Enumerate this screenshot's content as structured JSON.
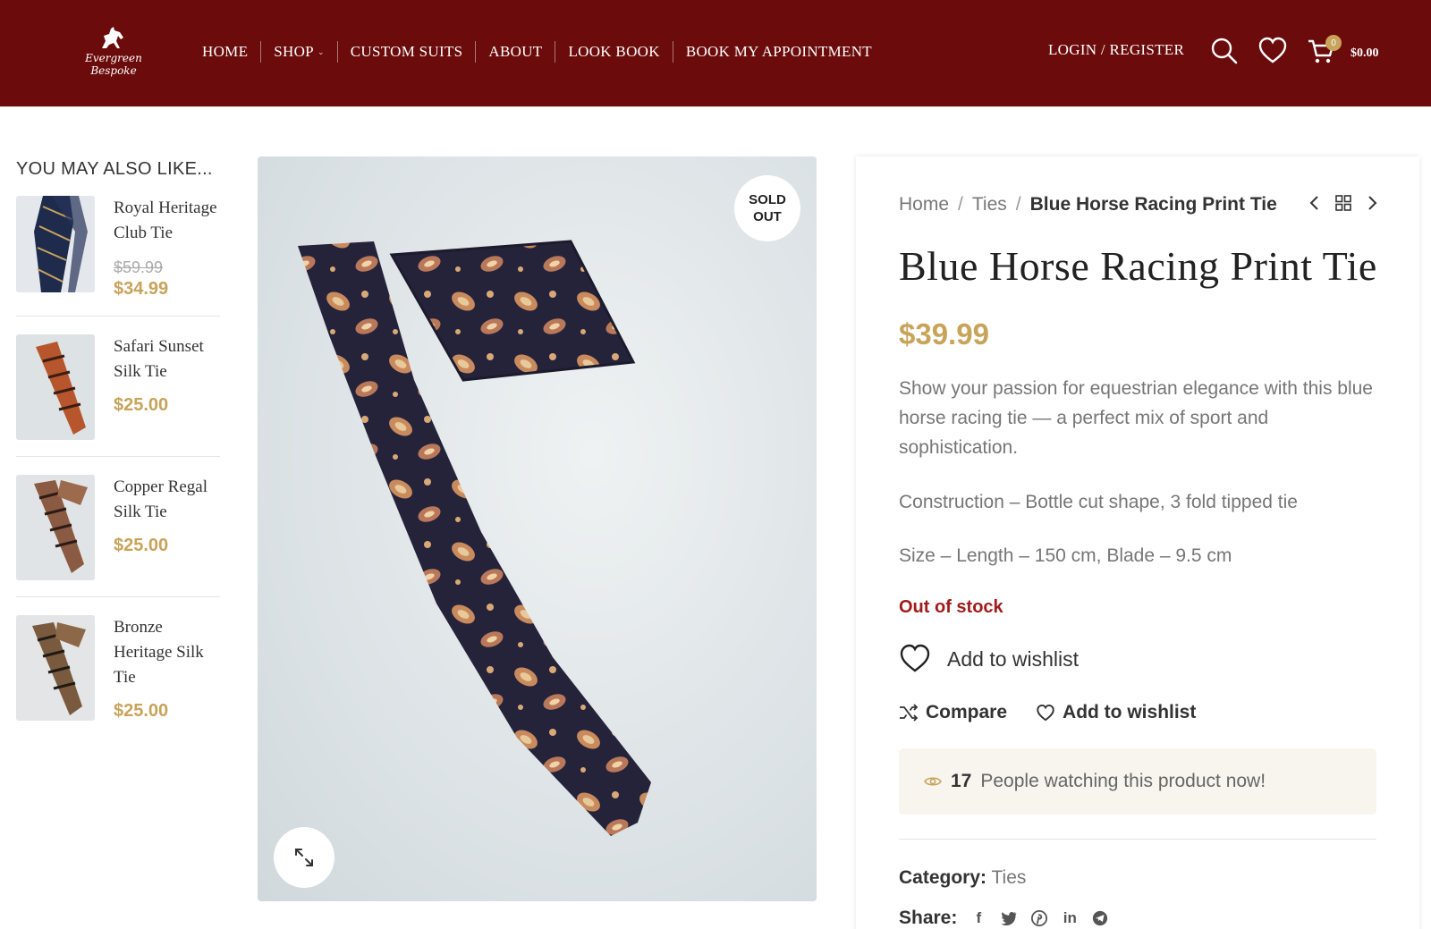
{
  "header": {
    "logo_text": "Evergreen Bespoke",
    "nav": [
      {
        "label": "HOME"
      },
      {
        "label": "SHOP"
      },
      {
        "label": "CUSTOM SUITS"
      },
      {
        "label": "ABOUT"
      },
      {
        "label": "LOOK BOOK"
      },
      {
        "label": "BOOK MY APPOINTMENT"
      }
    ],
    "login_label": "LOGIN / REGISTER",
    "cart_count": "0",
    "cart_total": "$0.00",
    "icons": [
      "search-icon",
      "heart-icon",
      "cart-icon"
    ]
  },
  "sidebar": {
    "title": "YOU MAY ALSO LIKE...",
    "items": [
      {
        "name": "Royal Heritage Club Tie",
        "old_price": "$59.99",
        "price": "$34.99"
      },
      {
        "name": "Safari Sunset Silk Tie",
        "price": "$25.00"
      },
      {
        "name": "Copper Regal Silk Tie",
        "price": "$25.00"
      },
      {
        "name": "Bronze Heritage Silk Tie",
        "price": "$25.00"
      }
    ]
  },
  "product": {
    "badge_line1": "SOLD",
    "badge_line2": "OUT",
    "breadcrumb": {
      "home": "Home",
      "category": "Ties",
      "current": "Blue Horse Racing Print Tie"
    },
    "title": "Blue Horse Racing Print Tie",
    "price": "$39.99",
    "description": "Show your passion for equestrian elegance with this blue horse racing tie — a perfect mix of sport and sophistication.",
    "construction": "Construction – Bottle cut shape, 3 fold tipped tie",
    "size": "Size – Length – 150 cm, Blade – 9.5 cm",
    "stock": "Out of stock",
    "wishlist_big": "Add to wishlist",
    "compare": "Compare",
    "wishlist_small": "Add to wishlist",
    "watching_count": "17",
    "watching_text": "People watching this product now!",
    "category_label": "Category:",
    "category_value": "Ties",
    "share_label": "Share:"
  },
  "colors": {
    "header_bg": "#6b0b0b",
    "accent_gold": "#c8a35a",
    "stock_red": "#a11b1b"
  }
}
